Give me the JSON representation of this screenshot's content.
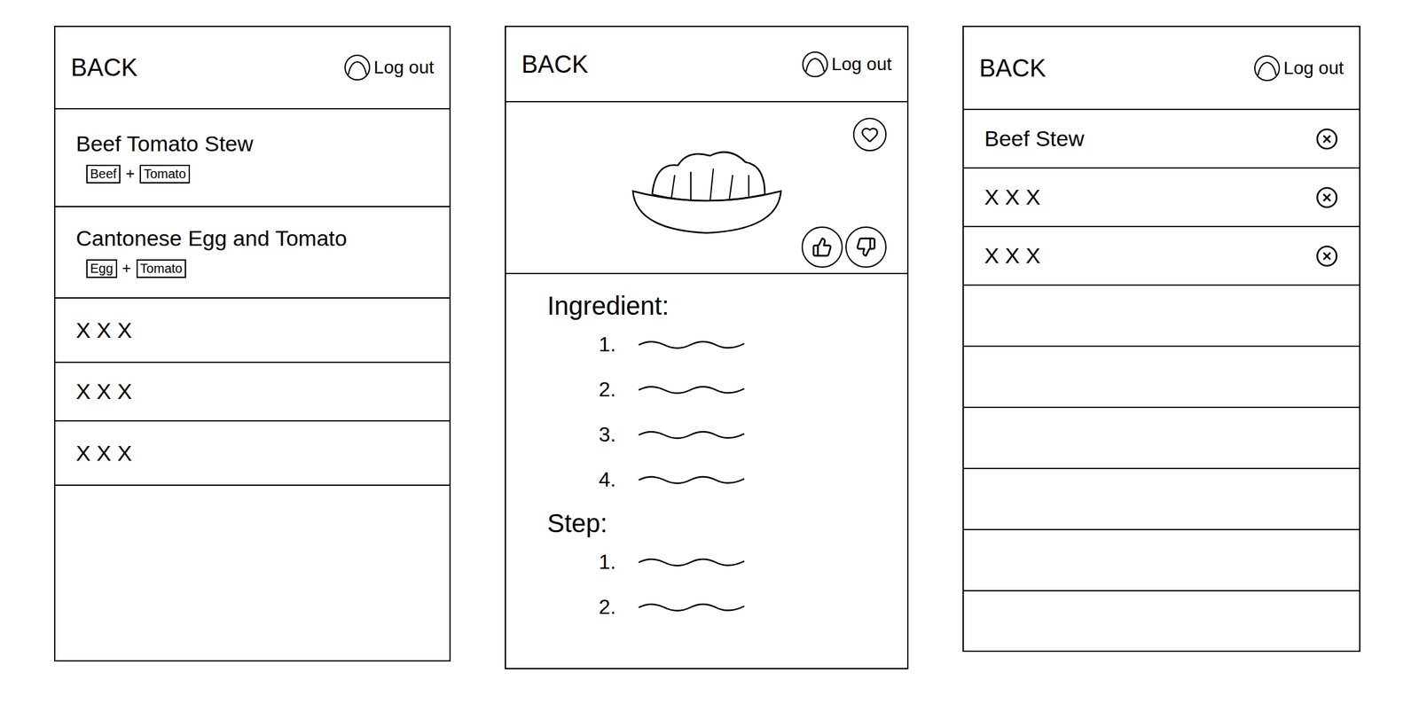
{
  "header": {
    "back": "BACK",
    "logout": "Log out"
  },
  "recipe_list": {
    "tag_joiner": "+",
    "items": [
      {
        "name": "Beef Tomato Stew",
        "tags": [
          "Beef",
          "Tomato"
        ]
      },
      {
        "name": "Cantonese Egg and Tomato",
        "tags": [
          "Egg",
          "Tomato"
        ]
      },
      {
        "name": "X X X",
        "tags": []
      },
      {
        "name": "X X X",
        "tags": []
      },
      {
        "name": "X X X",
        "tags": []
      }
    ]
  },
  "recipe_detail": {
    "favorited": false,
    "liked": false,
    "disliked": false,
    "ingredient_title": "Ingredient:",
    "ingredients": [
      "1.",
      "2.",
      "3.",
      "4."
    ],
    "step_title": "Step:",
    "steps": [
      "1.",
      "2."
    ]
  },
  "favorites": [
    {
      "name": "Beef Stew"
    },
    {
      "name": "X X X"
    },
    {
      "name": "X X X"
    }
  ]
}
